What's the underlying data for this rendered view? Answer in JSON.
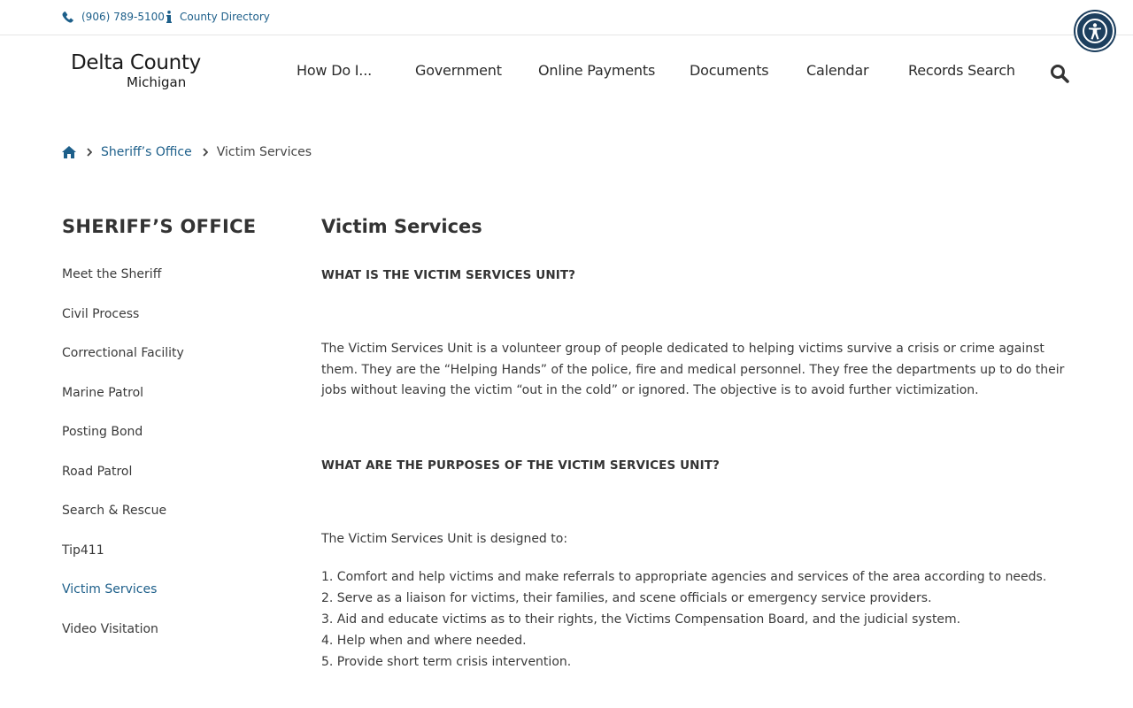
{
  "utility": {
    "phone": "(906) 789-5100",
    "directory": "County Directory"
  },
  "logo": {
    "county": "Delta County",
    "state": "Michigan"
  },
  "nav": {
    "items": [
      "How Do I...",
      "Government",
      "Online Payments",
      "Documents",
      "Calendar",
      "Records Search"
    ]
  },
  "breadcrumb": {
    "parent": "Sheriff’s Office",
    "current": "Victim Services"
  },
  "sidebar": {
    "title": "SHERIFF’S OFFICE",
    "items": [
      "Meet the Sheriff",
      "Civil Process",
      "Correctional Facility",
      "Marine Patrol",
      "Posting Bond",
      "Road Patrol",
      "Search & Rescue",
      "Tip411",
      "Victim Services",
      "Video Visitation"
    ],
    "active_index": 8
  },
  "content": {
    "title": "Victim Services",
    "heading1": "WHAT IS THE VICTIM SERVICES UNIT?",
    "paragraph1": "The Victim Services Unit is a volunteer group of people dedicated to helping victims survive a crisis or crime against them. They are the “Helping Hands” of the police, fire and medical personnel. They free the departments up to do their jobs without leaving the victim “out in the cold” or ignored. The objective is to avoid further victimization.",
    "heading2": "WHAT ARE THE PURPOSES OF THE VICTIM SERVICES UNIT?",
    "paragraph2": "The Victim Services Unit is designed to:",
    "purposes": [
      "1. Comfort and help victims and make referrals to appropriate agencies and services of the area according to needs.",
      "2. Serve as a liaison for victims, their families, and scene officials or emergency service providers.",
      "3. Aid and educate victims as to their rights, the Victims Compensation Board, and the judicial system.",
      "4. Help when and where needed.",
      "5. Provide short term crisis intervention."
    ]
  },
  "colors": {
    "link": "#1d5f8a",
    "accessibility_button": "#1d3f5e"
  }
}
